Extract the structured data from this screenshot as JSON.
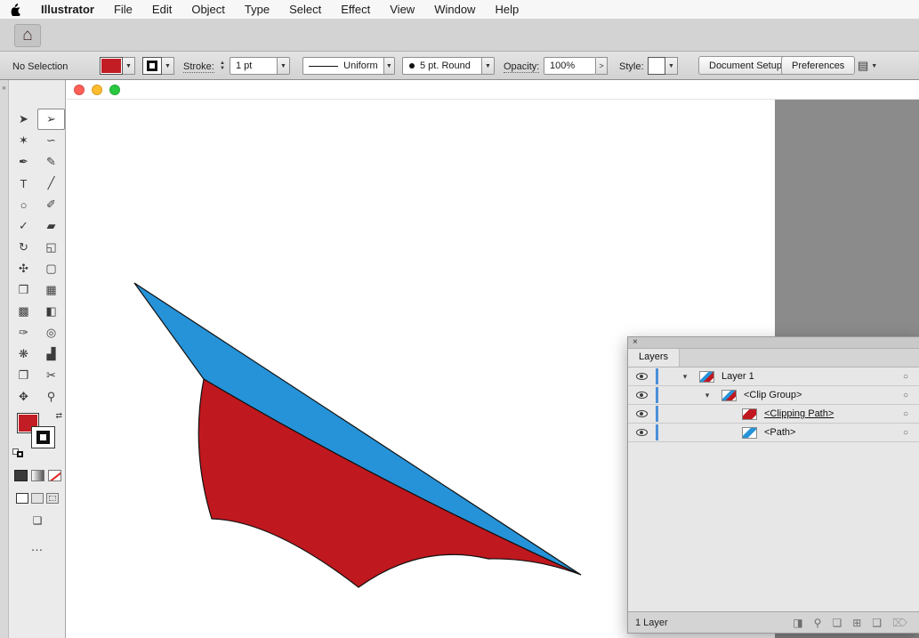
{
  "window": {
    "traffic_lights": [
      "#ff5f57",
      "#febc2e",
      "#28c840"
    ]
  },
  "menu_bar": {
    "app_name": "Illustrator",
    "items": [
      "File",
      "Edit",
      "Object",
      "Type",
      "Select",
      "Effect",
      "View",
      "Window",
      "Help"
    ]
  },
  "app_bar": {
    "home_glyph": "⌂"
  },
  "control_bar": {
    "selection_status": "No Selection",
    "fill_color": "#c21d24",
    "stroke_label": "Stroke:",
    "stroke_weight": "1 pt",
    "stroke_profile": "Uniform",
    "brush": "5 pt. Round",
    "opacity_label": "Opacity:",
    "opacity_value": "100%",
    "opacity_more": ">",
    "style_label": "Style:",
    "document_setup_label": "Document Setup",
    "preferences_label": "Preferences",
    "arrange_glyph": "▤"
  },
  "dock": {
    "collapse_glyph": "«"
  },
  "toolbar": {
    "tools": [
      {
        "name": "selection-tool",
        "glyph": "➤"
      },
      {
        "name": "direct-selection-tool",
        "glyph": "➢"
      },
      {
        "name": "magic-wand-tool",
        "glyph": "✶"
      },
      {
        "name": "lasso-tool",
        "glyph": "∽"
      },
      {
        "name": "pen-tool",
        "glyph": "✒"
      },
      {
        "name": "curvature-tool",
        "glyph": "✎"
      },
      {
        "name": "type-tool",
        "glyph": "T"
      },
      {
        "name": "line-segment-tool",
        "glyph": "╱"
      },
      {
        "name": "ellipse-tool",
        "glyph": "○"
      },
      {
        "name": "paintbrush-tool",
        "glyph": "✐"
      },
      {
        "name": "shaper-tool",
        "glyph": "✓"
      },
      {
        "name": "eraser-tool",
        "glyph": "▰"
      },
      {
        "name": "rotate-tool",
        "glyph": "↻"
      },
      {
        "name": "scale-tool",
        "glyph": "◱"
      },
      {
        "name": "width-tool",
        "glyph": "✣"
      },
      {
        "name": "free-transform-tool",
        "glyph": "▢"
      },
      {
        "name": "shape-builder-tool",
        "glyph": "❒"
      },
      {
        "name": "perspective-grid-tool",
        "glyph": "▦"
      },
      {
        "name": "mesh-tool",
        "glyph": "▩"
      },
      {
        "name": "gradient-tool",
        "glyph": "◧"
      },
      {
        "name": "eyedropper-tool",
        "glyph": "✑"
      },
      {
        "name": "blend-tool",
        "glyph": "◎"
      },
      {
        "name": "symbol-sprayer-tool",
        "glyph": "❋"
      },
      {
        "name": "column-graph-tool",
        "glyph": "▟"
      },
      {
        "name": "artboard-tool",
        "glyph": "❐"
      },
      {
        "name": "slice-tool",
        "glyph": "✂"
      },
      {
        "name": "hand-tool",
        "glyph": "✥"
      },
      {
        "name": "zoom-tool",
        "glyph": "⚲"
      }
    ],
    "swap_glyph": "⇄",
    "screen_mode_glyph": "❏",
    "more_glyph": "…"
  },
  "canvas": {
    "blue": "#2693d8",
    "red": "#c0181f"
  },
  "layers_panel": {
    "close_glyph": "×",
    "tab": "Layers",
    "expander_glyph": "▾",
    "target_glyph": "○",
    "rows": [
      {
        "label": "Layer 1"
      },
      {
        "label": "<Clip Group>"
      },
      {
        "label": "<Clipping Path>"
      },
      {
        "label": "<Path>"
      }
    ],
    "footer": {
      "count": "1 Layer",
      "icons": [
        {
          "glyph": "◨"
        },
        {
          "glyph": "⚲"
        },
        {
          "glyph": "❏"
        },
        {
          "glyph": "⊞"
        },
        {
          "glyph": "❑"
        },
        {
          "glyph": "⌦"
        }
      ]
    }
  }
}
